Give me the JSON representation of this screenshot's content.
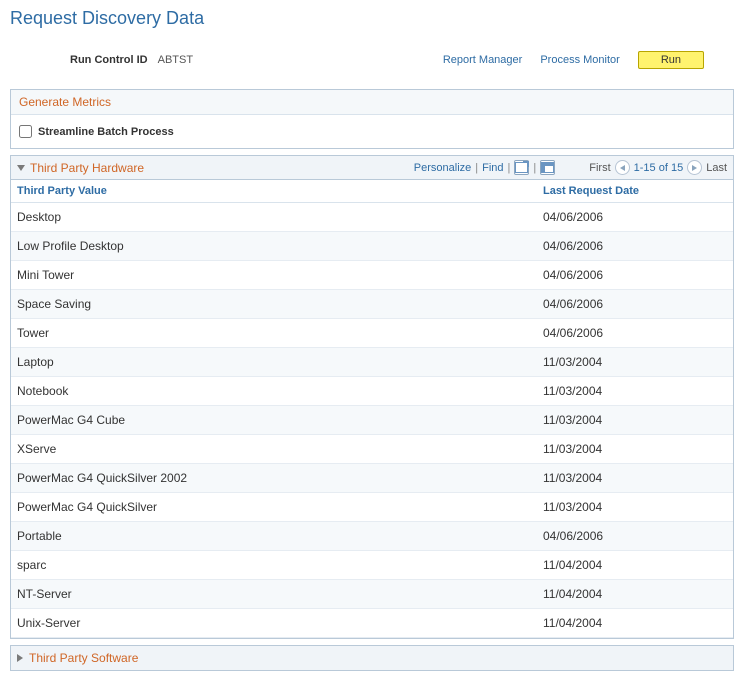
{
  "page_title": "Request Discovery Data",
  "run_control": {
    "label": "Run Control ID",
    "value": "ABTST"
  },
  "toolbar": {
    "report_manager": "Report Manager",
    "process_monitor": "Process Monitor",
    "run_label": "Run"
  },
  "panel": {
    "title": "Generate Metrics",
    "checkbox_label": "Streamline Batch Process"
  },
  "grid": {
    "title": "Third Party Hardware",
    "personalize": "Personalize",
    "find": "Find",
    "nav": {
      "first": "First",
      "range": "1-15 of 15",
      "last": "Last"
    },
    "columns": {
      "value": "Third Party Value",
      "date": "Last Request Date"
    },
    "rows": [
      {
        "value": "Desktop",
        "date": "04/06/2006"
      },
      {
        "value": "Low Profile Desktop",
        "date": "04/06/2006"
      },
      {
        "value": "Mini Tower",
        "date": "04/06/2006"
      },
      {
        "value": "Space Saving",
        "date": "04/06/2006"
      },
      {
        "value": "Tower",
        "date": "04/06/2006"
      },
      {
        "value": "Laptop",
        "date": "11/03/2004"
      },
      {
        "value": "Notebook",
        "date": "11/03/2004"
      },
      {
        "value": "PowerMac G4 Cube",
        "date": "11/03/2004"
      },
      {
        "value": "XServe",
        "date": "11/03/2004"
      },
      {
        "value": "PowerMac G4 QuickSilver 2002",
        "date": "11/03/2004"
      },
      {
        "value": "PowerMac G4 QuickSilver",
        "date": "11/03/2004"
      },
      {
        "value": "Portable",
        "date": "04/06/2006"
      },
      {
        "value": "sparc",
        "date": "11/04/2004"
      },
      {
        "value": "NT-Server",
        "date": "11/04/2004"
      },
      {
        "value": "Unix-Server",
        "date": "11/04/2004"
      }
    ]
  },
  "collapsed_section": {
    "title": "Third Party Software"
  }
}
